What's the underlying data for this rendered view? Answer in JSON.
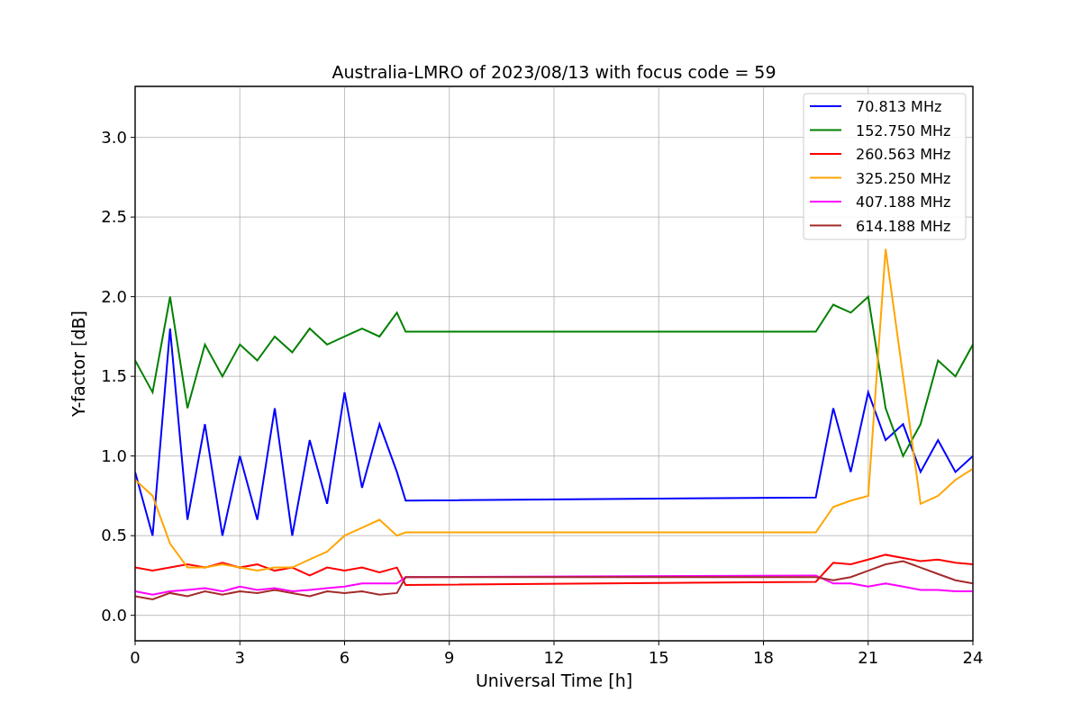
{
  "figure": {
    "chart_data": {
      "type": "line",
      "title": "Australia-LMRO of 2023/08/13 with focus code = 59",
      "xlabel": "Universal Time [h]",
      "ylabel": "Y-factor [dB]",
      "x": [
        0,
        0.5,
        1,
        1.5,
        2,
        2.5,
        3,
        3.5,
        4,
        4.5,
        5,
        5.5,
        6,
        6.5,
        7,
        7.5,
        7.75,
        19.5,
        20,
        20.5,
        21,
        21.5,
        22,
        22.5,
        23,
        23.5,
        24
      ],
      "xlim": [
        0,
        24
      ],
      "ylim": [
        -0.16,
        3.32
      ],
      "xticks": [
        0,
        3,
        6,
        9,
        12,
        15,
        18,
        21,
        24
      ],
      "grid": true,
      "legend": true,
      "yticks": [
        {
          "value": 0,
          "label": "0.0"
        },
        {
          "value": 0.5,
          "label": "0.5"
        },
        {
          "value": 1,
          "label": "1.0"
        },
        {
          "value": 1.5,
          "label": "1.5"
        },
        {
          "value": 2,
          "label": "2.0"
        },
        {
          "value": 2.5,
          "label": "2.5"
        },
        {
          "value": 3,
          "label": "3.0"
        }
      ],
      "series": [
        {
          "name": "70.813 MHz",
          "color": "#0000ff",
          "values": [
            0.9,
            0.5,
            1.8,
            0.6,
            1.2,
            0.5,
            1.0,
            0.6,
            1.3,
            0.5,
            1.1,
            0.7,
            1.4,
            0.8,
            1.2,
            0.9,
            0.72,
            0.74,
            1.3,
            0.9,
            1.4,
            1.1,
            1.2,
            0.9,
            1.1,
            0.9,
            1.0
          ]
        },
        {
          "name": "152.750 MHz",
          "color": "#008000",
          "values": [
            1.6,
            1.4,
            2.0,
            1.3,
            1.7,
            1.5,
            1.7,
            1.6,
            1.75,
            1.65,
            1.8,
            1.7,
            1.75,
            1.8,
            1.75,
            1.9,
            1.78,
            1.78,
            1.95,
            1.9,
            2.0,
            1.3,
            1.0,
            1.2,
            1.6,
            1.5,
            1.7
          ]
        },
        {
          "name": "260.563 MHz",
          "color": "#ff0000",
          "values": [
            0.3,
            0.28,
            0.3,
            0.32,
            0.3,
            0.33,
            0.3,
            0.32,
            0.28,
            0.3,
            0.25,
            0.3,
            0.28,
            0.3,
            0.27,
            0.3,
            0.19,
            0.21,
            0.33,
            0.32,
            0.35,
            0.38,
            0.36,
            0.34,
            0.35,
            0.33,
            0.32
          ]
        },
        {
          "name": "325.250 MHz",
          "color": "#ffa500",
          "values": [
            0.85,
            0.75,
            0.45,
            0.3,
            0.3,
            0.32,
            0.3,
            0.28,
            0.3,
            0.3,
            0.35,
            0.4,
            0.5,
            0.55,
            0.6,
            0.5,
            0.52,
            0.52,
            0.68,
            0.72,
            0.75,
            2.3,
            1.5,
            0.7,
            0.75,
            0.85,
            0.92
          ]
        },
        {
          "name": "407.188 MHz",
          "color": "#ff00ff",
          "values": [
            0.15,
            0.13,
            0.15,
            0.16,
            0.17,
            0.15,
            0.18,
            0.16,
            0.17,
            0.15,
            0.16,
            0.17,
            0.18,
            0.2,
            0.2,
            0.2,
            0.24,
            0.25,
            0.2,
            0.2,
            0.18,
            0.2,
            0.18,
            0.16,
            0.16,
            0.15,
            0.15
          ]
        },
        {
          "name": "614.188 MHz",
          "color": "#a52a2a",
          "values": [
            0.12,
            0.1,
            0.14,
            0.12,
            0.15,
            0.13,
            0.15,
            0.14,
            0.16,
            0.14,
            0.12,
            0.15,
            0.14,
            0.15,
            0.13,
            0.14,
            0.24,
            0.24,
            0.22,
            0.24,
            0.28,
            0.32,
            0.34,
            0.3,
            0.26,
            0.22,
            0.2
          ]
        }
      ]
    }
  }
}
